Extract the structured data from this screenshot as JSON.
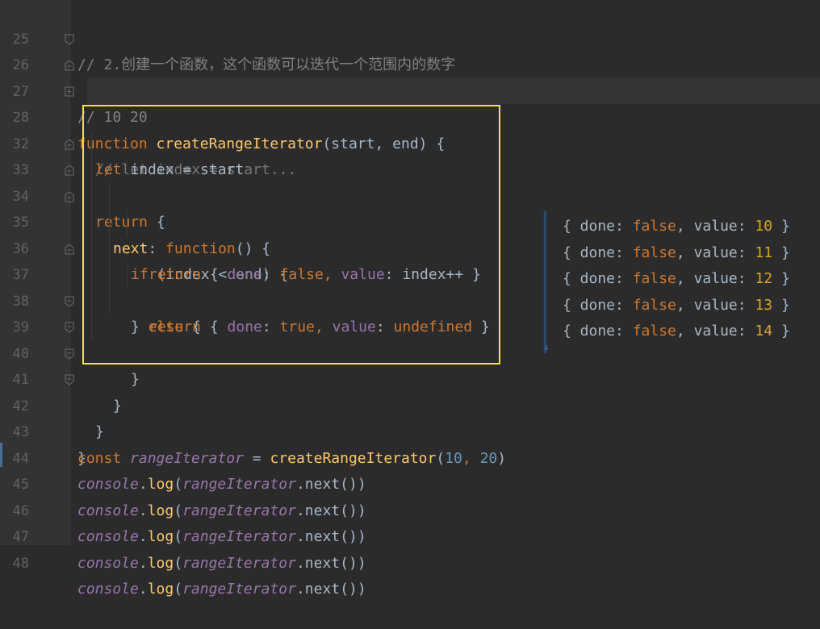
{
  "editor": {
    "lines": [
      {
        "num": "25",
        "text": "// 2.创建一个函数，这个函数可以迭代一个范围内的数字"
      },
      {
        "num": "26",
        "text": "// 10 20"
      },
      {
        "num": "27",
        "kw": "function",
        "name": "createRangeIterator",
        "params": "(start, end) {"
      },
      {
        "num": "28",
        "folded": "// let index = start..."
      },
      {
        "num": "32",
        "kw": "let",
        "rest": " index = start"
      },
      {
        "num": "33",
        "kw": "return",
        "rest": " {"
      },
      {
        "num": "34",
        "prop": "next",
        "colon": ": ",
        "kw": "function",
        "rest": "() {"
      },
      {
        "num": "35",
        "kw": "if",
        "rest": " (index < end) {"
      },
      {
        "num": "36",
        "kw": "return",
        "open": " { ",
        "k1": "done",
        "c1": ": ",
        "v1": "false",
        "sep": ", ",
        "k2": "value",
        "c2": ": ",
        "v2": "index++",
        "close": " }"
      },
      {
        "num": "37",
        "pre": "} ",
        "kw": "else",
        "rest": " {"
      },
      {
        "num": "38",
        "kw": "return",
        "open": " { ",
        "k1": "done",
        "c1": ": ",
        "v1": "true",
        "sep": ", ",
        "k2": "value",
        "c2": ": ",
        "v2": "undefined",
        "close": " }"
      },
      {
        "num": "39",
        "text": "}"
      },
      {
        "num": "40",
        "text": "}"
      },
      {
        "num": "41",
        "text": "}"
      },
      {
        "num": "42",
        "text": "}"
      },
      {
        "num": "43",
        "kw": "const",
        "var": "rangeIterator",
        "eq": " = ",
        "call": "createRangeIterator",
        "open": "(",
        "a1": "10",
        "sep": ", ",
        "a2": "20",
        "close": ")"
      },
      {
        "num": "44",
        "obj": "console",
        "dot": ".",
        "method": "log",
        "open": "(",
        "var": "rangeIterator",
        "call": ".next()",
        "close": ")"
      },
      {
        "num": "45",
        "obj": "console",
        "dot": ".",
        "method": "log",
        "open": "(",
        "var": "rangeIterator",
        "call": ".next()",
        "close": ")"
      },
      {
        "num": "46",
        "obj": "console",
        "dot": ".",
        "method": "log",
        "open": "(",
        "var": "rangeIterator",
        "call": ".next()",
        "close": ")"
      },
      {
        "num": "47",
        "obj": "console",
        "dot": ".",
        "method": "log",
        "open": "(",
        "var": "rangeIterator",
        "call": ".next()",
        "close": ")"
      },
      {
        "num": "48",
        "obj": "console",
        "dot": ".",
        "method": "log",
        "open": "(",
        "var": "rangeIterator",
        "call": ".next()",
        "close": ")"
      }
    ]
  },
  "output": {
    "entries": [
      {
        "open": "{ done: ",
        "done": "false",
        "mid": ", value: ",
        "value": "10",
        "close": " }"
      },
      {
        "open": "{ done: ",
        "done": "false",
        "mid": ", value: ",
        "value": "11",
        "close": " }"
      },
      {
        "open": "{ done: ",
        "done": "false",
        "mid": ", value: ",
        "value": "12",
        "close": " }"
      },
      {
        "open": "{ done: ",
        "done": "false",
        "mid": ", value: ",
        "value": "13",
        "close": " }"
      },
      {
        "open": "{ done: ",
        "done": "false",
        "mid": ", value: ",
        "value": "14",
        "close": " }"
      }
    ],
    "arrow_icon": "down-arrow-icon"
  },
  "colors": {
    "background": "#2b2b2b",
    "keyword": "#cc7832",
    "function_name": "#ffc66d",
    "property": "#9876aa",
    "number": "#6897bb",
    "comment": "#808080",
    "highlight_border": "#f3e33a"
  }
}
